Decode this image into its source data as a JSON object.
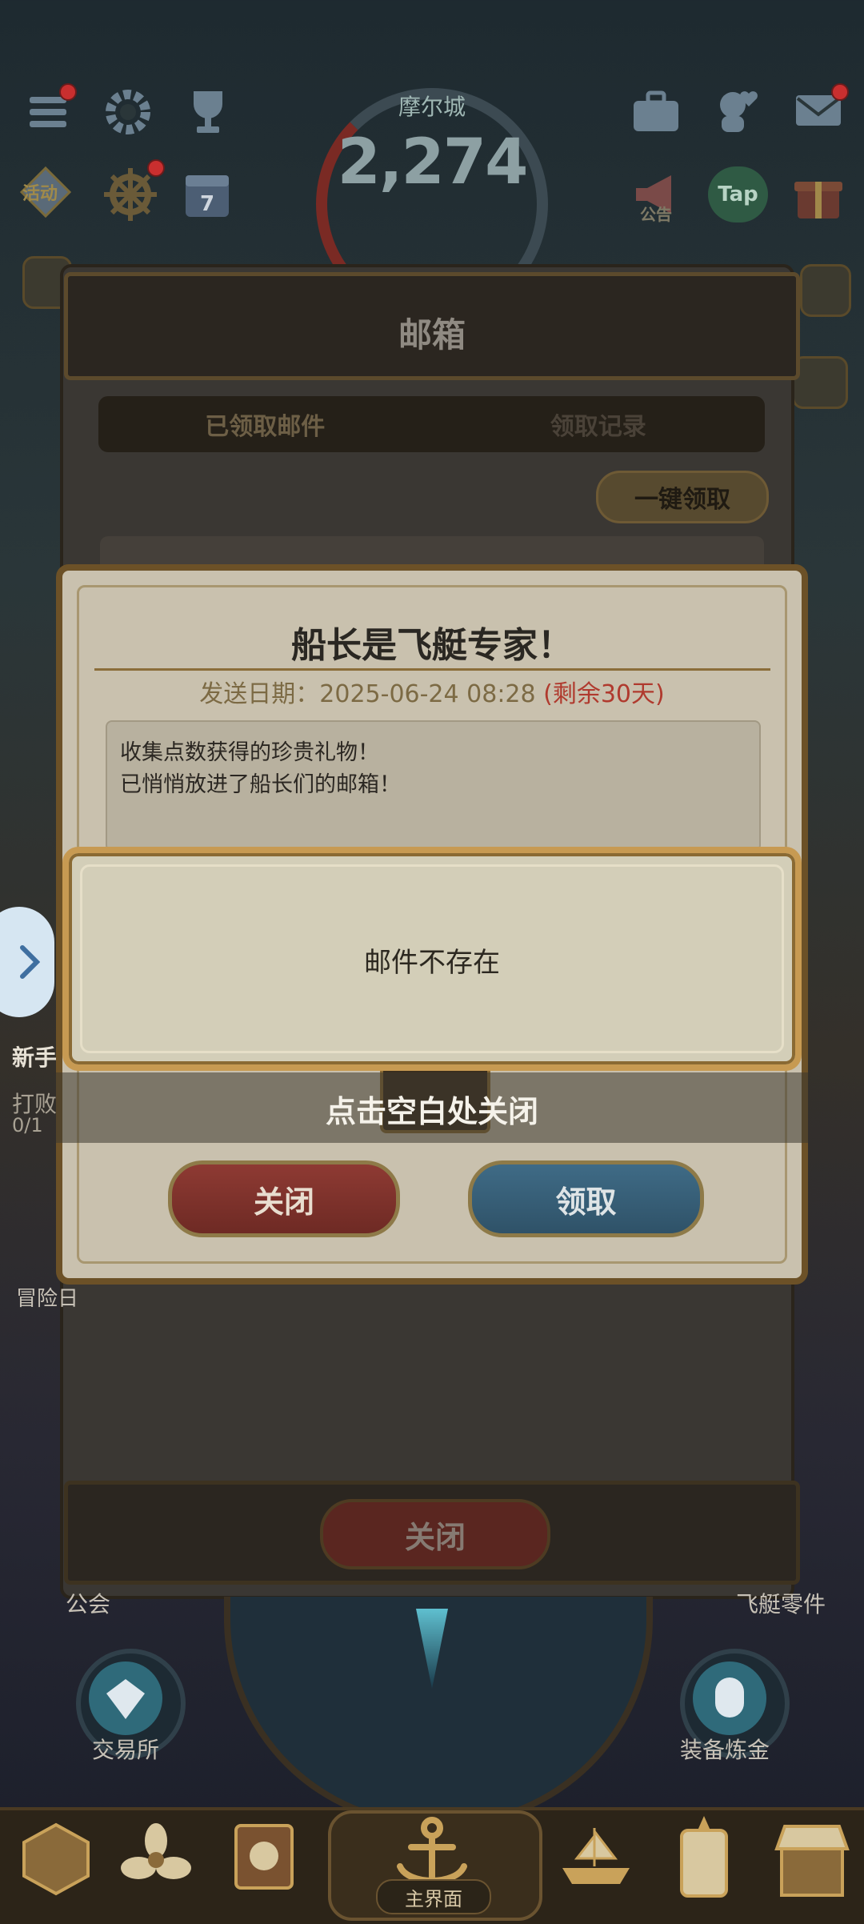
{
  "hud": {
    "city_name": "摩尔城",
    "city_value": "2,274",
    "left_icons": [
      "menu-icon",
      "gear-icon",
      "trophy-icon"
    ],
    "row2_left": {
      "activity_label": "活动"
    },
    "right_labels": {
      "announce": "公告",
      "tap": "Tap"
    }
  },
  "mailbox": {
    "title": "邮箱",
    "tabs": [
      "已领取邮件",
      "领取记录"
    ],
    "claim_all": "一键领取",
    "close": "关闭"
  },
  "letter": {
    "title": "船长是飞艇专家！",
    "date_prefix": "发送日期：2025-06-24 08:28 ",
    "date_remaining": "(剩余30天)",
    "body_lines": [
      "收集点数获得的珍贵礼物！",
      "已悄悄放进了船长们的邮箱！"
    ],
    "close_button": "关闭",
    "claim_button": "领取"
  },
  "toast": {
    "message": "邮件不存在",
    "dismiss_hint": "点击空白处关闭"
  },
  "background_labels": {
    "left_1": "新手",
    "left_2": "打败",
    "left_3": "0/1",
    "left_4": "冒险日",
    "guild": "公会",
    "parts": "飞艇零件",
    "exchange": "交易所",
    "alchemy": "装备炼金"
  },
  "bottom_nav": {
    "home_label": "主界面"
  },
  "colors": {
    "accent_gold": "#c79a52",
    "date_red": "#b03a2e",
    "button_red": "#8e3a33",
    "button_blue": "#3f6b86"
  }
}
